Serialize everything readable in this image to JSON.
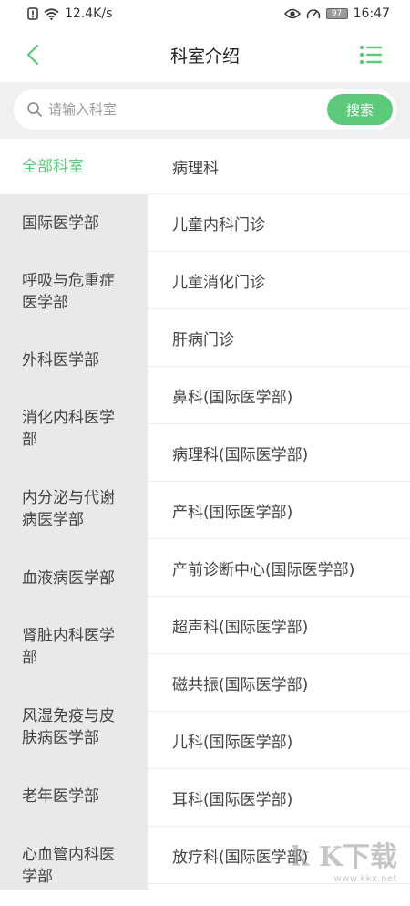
{
  "statusbar": {
    "speed": "12.4K/s",
    "battery": "97",
    "time": "16:47"
  },
  "header": {
    "title": "科室介绍"
  },
  "search": {
    "placeholder": "请输入科室",
    "button_label": "搜索"
  },
  "left_menu": [
    {
      "label": "全部科室"
    },
    {
      "label": "国际医学部"
    },
    {
      "label": "呼吸与危重症医学部"
    },
    {
      "label": "外科医学部"
    },
    {
      "label": "消化内科医学部"
    },
    {
      "label": "内分泌与代谢病医学部"
    },
    {
      "label": "血液病医学部"
    },
    {
      "label": "肾脏内科医学部"
    },
    {
      "label": "风湿免疫与皮肤病医学部"
    },
    {
      "label": "老年医学部"
    },
    {
      "label": "心血管内科医学部"
    }
  ],
  "department_list": [
    {
      "label": "病理科"
    },
    {
      "label": "儿童内科门诊"
    },
    {
      "label": "儿童消化门诊"
    },
    {
      "label": "肝病门诊"
    },
    {
      "label": "鼻科(国际医学部)"
    },
    {
      "label": "病理科(国际医学部)"
    },
    {
      "label": "产科(国际医学部)"
    },
    {
      "label": "产前诊断中心(国际医学部)"
    },
    {
      "label": "超声科(国际医学部)"
    },
    {
      "label": "磁共振(国际医学部)"
    },
    {
      "label": "儿科(国际医学部)"
    },
    {
      "label": "耳科(国际医学部)"
    },
    {
      "label": "放疗科(国际医学部)"
    }
  ],
  "watermark": {
    "logo": "k K下载",
    "url": "www.kkx.net"
  },
  "colors": {
    "accent": "#5dc97a",
    "sidebar_bg": "#e9e9e9",
    "search_bg": "#f0f0f0"
  }
}
